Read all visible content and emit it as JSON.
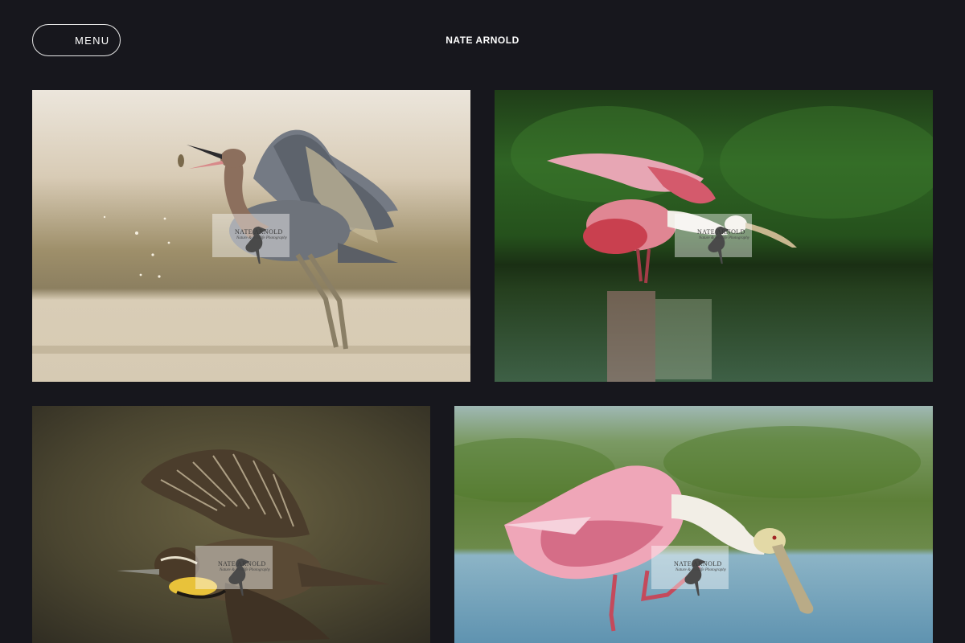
{
  "header": {
    "menu_label": "MENU",
    "site_title": "NATE ARNOLD"
  },
  "watermark": {
    "name": "NATE ARNOLD",
    "tagline": "Nature & Wildlife Photography"
  },
  "gallery": [
    {
      "subject": "reddish-egret"
    },
    {
      "subject": "roseate-spoonbill-wings-open"
    },
    {
      "subject": "meadowlark-in-flight"
    },
    {
      "subject": "roseate-spoonbill-feeding"
    }
  ],
  "colors": {
    "background": "#17171d",
    "text": "#ffffff"
  }
}
